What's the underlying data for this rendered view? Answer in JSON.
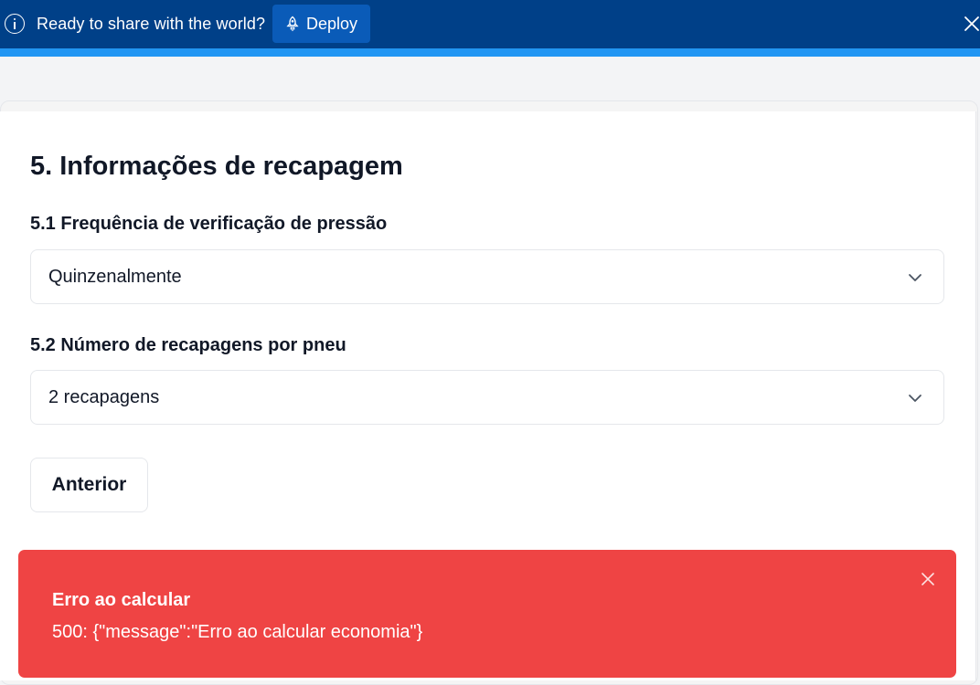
{
  "deploy_bar": {
    "message": "Ready to share with the world?",
    "button_label": "Deploy",
    "icons": {
      "info": "info-icon",
      "deploy": "rocket-icon",
      "close": "close-icon"
    },
    "colors": {
      "background": "#004088",
      "button": "#0a5bb8",
      "accent_strip": "#2196f3"
    }
  },
  "section": {
    "title": "5. Informações de recapagem"
  },
  "fields": [
    {
      "label": "5.1 Frequência de verificação de pressão",
      "value": "Quinzenalmente",
      "icon": "chevron-down-icon"
    },
    {
      "label": "5.2 Número de recapagens por pneu",
      "value": "2 recapagens",
      "icon": "chevron-down-icon"
    }
  ],
  "buttons": {
    "previous_label": "Anterior"
  },
  "toast": {
    "title": "Erro ao calcular",
    "description": "500: {\"message\":\"Erro ao calcular economia\"}",
    "icon": "close-icon",
    "color": "#ef4444"
  }
}
